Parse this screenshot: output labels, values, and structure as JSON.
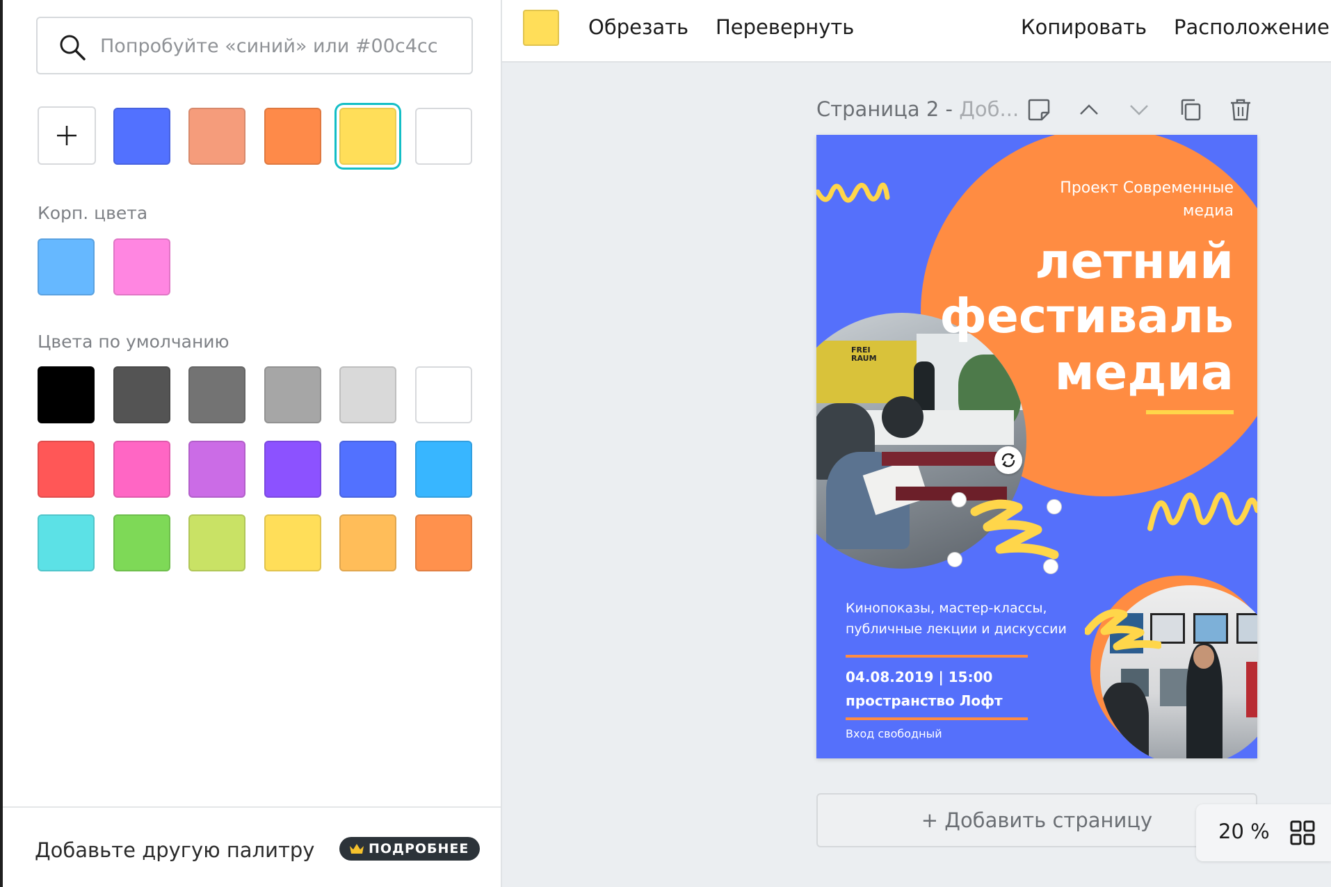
{
  "search": {
    "placeholder": "Попробуйте «синий» или #00c4cc"
  },
  "document_colors": [
    {
      "hex": "#5271ff"
    },
    {
      "hex": "#f59c7b"
    },
    {
      "hex": "#fe8a49"
    },
    {
      "hex": "#ffde59",
      "selected": true
    },
    {
      "hex": "#ffffff"
    }
  ],
  "brand": {
    "label": "Корп. цвета",
    "colors": [
      "#66b8ff",
      "#ff86e1"
    ]
  },
  "defaults": {
    "label": "Цвета по умолчанию",
    "colors": [
      "#000000",
      "#545454",
      "#737373",
      "#a6a6a6",
      "#d9d9d9",
      "#ffffff",
      "#ff5757",
      "#ff66c4",
      "#cb6ce6",
      "#8c52ff",
      "#5271ff",
      "#38b6ff",
      "#5ce1e6",
      "#7ed957",
      "#c9e265",
      "#ffde59",
      "#ffbd59",
      "#ff914d"
    ]
  },
  "footer": {
    "text": "Добавьте другую палитру",
    "badge": "ПОДРОБНЕЕ"
  },
  "toolbar": {
    "current_color": "#ffde59",
    "crop": "Обрезать",
    "flip": "Перевернуть",
    "copy": "Копировать",
    "position": "Расположение"
  },
  "page": {
    "label": "Страница 2 - ",
    "subtitle": "Доб..."
  },
  "poster": {
    "project": "Проект Современные\nмедиа",
    "headline1": "летний",
    "headline2": "фестиваль",
    "headline3": "медиа",
    "desc": "Кинопоказы, мастер-классы,\nпубличные лекции и дискуссии",
    "date": "04.08.2019 | 15:00",
    "venue": "пространство Лофт",
    "entry": "Вход свободный",
    "photo_sign": "FREI\nRAUM",
    "colors": {
      "bg": "#5570fb",
      "orange": "#ff8c42",
      "yellow": "#ffd64a"
    }
  },
  "add_page": "+ Добавить страницу",
  "zoom": {
    "value": "20 %"
  }
}
